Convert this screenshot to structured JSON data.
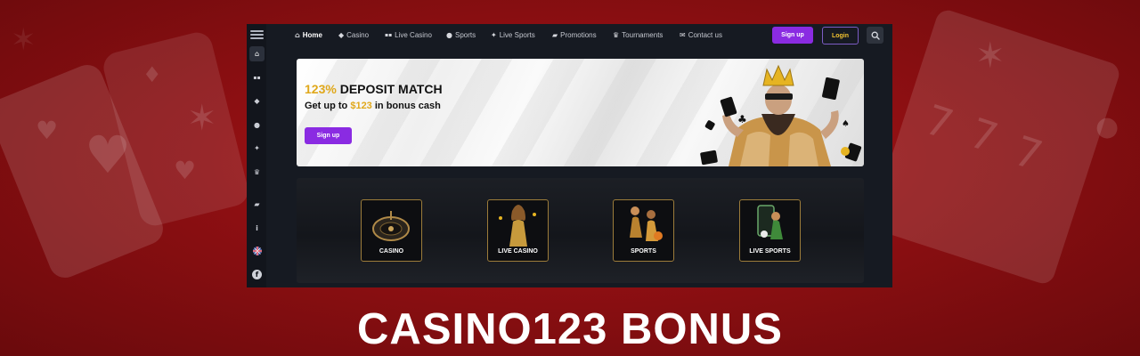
{
  "sidebar": {
    "items": [
      {
        "name": "home-icon",
        "glyph": "⌂",
        "active": true
      },
      {
        "name": "live-casino-icon",
        "glyph": "▪▪",
        "active": false
      },
      {
        "name": "casino-icon",
        "glyph": "◆",
        "active": false
      },
      {
        "name": "sports-icon",
        "glyph": "●",
        "active": false
      },
      {
        "name": "live-sports-icon",
        "glyph": "✦",
        "active": false
      },
      {
        "name": "tournaments-icon",
        "glyph": "♛",
        "active": false
      },
      {
        "name": "promotions-icon",
        "glyph": "▰",
        "active": false
      },
      {
        "name": "info-icon",
        "glyph": "i",
        "active": false
      },
      {
        "name": "uk-flag-icon",
        "glyph": "",
        "active": false
      },
      {
        "name": "facebook-icon",
        "glyph": "f",
        "active": false
      }
    ]
  },
  "nav": {
    "items": [
      {
        "label": "Home",
        "icon": "home-icon",
        "glyph": "⌂"
      },
      {
        "label": "Casino",
        "icon": "casino-icon",
        "glyph": "◆"
      },
      {
        "label": "Live Casino",
        "icon": "live-casino-icon",
        "glyph": "▪▪"
      },
      {
        "label": "Sports",
        "icon": "sports-icon",
        "glyph": "●"
      },
      {
        "label": "Live Sports",
        "icon": "live-sports-icon",
        "glyph": "✦"
      },
      {
        "label": "Promotions",
        "icon": "promotions-icon",
        "glyph": "▰"
      },
      {
        "label": "Tournaments",
        "icon": "tournaments-icon",
        "glyph": "♛"
      },
      {
        "label": "Contact us",
        "icon": "contact-icon",
        "glyph": "✉"
      }
    ],
    "signup_label": "Sign up",
    "login_label": "Login"
  },
  "banner": {
    "headline_accent": "123%",
    "headline_rest": " DEPOSIT MATCH",
    "sub_pre": "Get up to ",
    "sub_accent": "$123",
    "sub_post": " in bonus cash",
    "button_label": "Sign up"
  },
  "categories": [
    {
      "label": "CASINO"
    },
    {
      "label": "LIVE CASINO"
    },
    {
      "label": "SPORTS"
    },
    {
      "label": "LIVE SPORTS"
    }
  ],
  "page_title": "CASINO123 BONUS",
  "colors": {
    "accent_purple": "#8a2be2",
    "gold": "#e0a81b",
    "background_red": "#9c1114",
    "panel_dark": "#161a22"
  }
}
